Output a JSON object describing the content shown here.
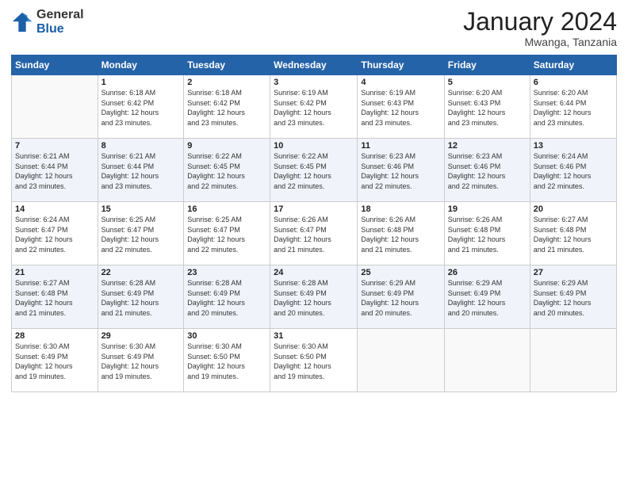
{
  "logo": {
    "general": "General",
    "blue": "Blue"
  },
  "title": "January 2024",
  "location": "Mwanga, Tanzania",
  "headers": [
    "Sunday",
    "Monday",
    "Tuesday",
    "Wednesday",
    "Thursday",
    "Friday",
    "Saturday"
  ],
  "weeks": [
    [
      {
        "day": "",
        "info": ""
      },
      {
        "day": "1",
        "info": "Sunrise: 6:18 AM\nSunset: 6:42 PM\nDaylight: 12 hours\nand 23 minutes."
      },
      {
        "day": "2",
        "info": "Sunrise: 6:18 AM\nSunset: 6:42 PM\nDaylight: 12 hours\nand 23 minutes."
      },
      {
        "day": "3",
        "info": "Sunrise: 6:19 AM\nSunset: 6:42 PM\nDaylight: 12 hours\nand 23 minutes."
      },
      {
        "day": "4",
        "info": "Sunrise: 6:19 AM\nSunset: 6:43 PM\nDaylight: 12 hours\nand 23 minutes."
      },
      {
        "day": "5",
        "info": "Sunrise: 6:20 AM\nSunset: 6:43 PM\nDaylight: 12 hours\nand 23 minutes."
      },
      {
        "day": "6",
        "info": "Sunrise: 6:20 AM\nSunset: 6:44 PM\nDaylight: 12 hours\nand 23 minutes."
      }
    ],
    [
      {
        "day": "7",
        "info": "Sunrise: 6:21 AM\nSunset: 6:44 PM\nDaylight: 12 hours\nand 23 minutes."
      },
      {
        "day": "8",
        "info": "Sunrise: 6:21 AM\nSunset: 6:44 PM\nDaylight: 12 hours\nand 23 minutes."
      },
      {
        "day": "9",
        "info": "Sunrise: 6:22 AM\nSunset: 6:45 PM\nDaylight: 12 hours\nand 22 minutes."
      },
      {
        "day": "10",
        "info": "Sunrise: 6:22 AM\nSunset: 6:45 PM\nDaylight: 12 hours\nand 22 minutes."
      },
      {
        "day": "11",
        "info": "Sunrise: 6:23 AM\nSunset: 6:46 PM\nDaylight: 12 hours\nand 22 minutes."
      },
      {
        "day": "12",
        "info": "Sunrise: 6:23 AM\nSunset: 6:46 PM\nDaylight: 12 hours\nand 22 minutes."
      },
      {
        "day": "13",
        "info": "Sunrise: 6:24 AM\nSunset: 6:46 PM\nDaylight: 12 hours\nand 22 minutes."
      }
    ],
    [
      {
        "day": "14",
        "info": "Sunrise: 6:24 AM\nSunset: 6:47 PM\nDaylight: 12 hours\nand 22 minutes."
      },
      {
        "day": "15",
        "info": "Sunrise: 6:25 AM\nSunset: 6:47 PM\nDaylight: 12 hours\nand 22 minutes."
      },
      {
        "day": "16",
        "info": "Sunrise: 6:25 AM\nSunset: 6:47 PM\nDaylight: 12 hours\nand 22 minutes."
      },
      {
        "day": "17",
        "info": "Sunrise: 6:26 AM\nSunset: 6:47 PM\nDaylight: 12 hours\nand 21 minutes."
      },
      {
        "day": "18",
        "info": "Sunrise: 6:26 AM\nSunset: 6:48 PM\nDaylight: 12 hours\nand 21 minutes."
      },
      {
        "day": "19",
        "info": "Sunrise: 6:26 AM\nSunset: 6:48 PM\nDaylight: 12 hours\nand 21 minutes."
      },
      {
        "day": "20",
        "info": "Sunrise: 6:27 AM\nSunset: 6:48 PM\nDaylight: 12 hours\nand 21 minutes."
      }
    ],
    [
      {
        "day": "21",
        "info": "Sunrise: 6:27 AM\nSunset: 6:48 PM\nDaylight: 12 hours\nand 21 minutes."
      },
      {
        "day": "22",
        "info": "Sunrise: 6:28 AM\nSunset: 6:49 PM\nDaylight: 12 hours\nand 21 minutes."
      },
      {
        "day": "23",
        "info": "Sunrise: 6:28 AM\nSunset: 6:49 PM\nDaylight: 12 hours\nand 20 minutes."
      },
      {
        "day": "24",
        "info": "Sunrise: 6:28 AM\nSunset: 6:49 PM\nDaylight: 12 hours\nand 20 minutes."
      },
      {
        "day": "25",
        "info": "Sunrise: 6:29 AM\nSunset: 6:49 PM\nDaylight: 12 hours\nand 20 minutes."
      },
      {
        "day": "26",
        "info": "Sunrise: 6:29 AM\nSunset: 6:49 PM\nDaylight: 12 hours\nand 20 minutes."
      },
      {
        "day": "27",
        "info": "Sunrise: 6:29 AM\nSunset: 6:49 PM\nDaylight: 12 hours\nand 20 minutes."
      }
    ],
    [
      {
        "day": "28",
        "info": "Sunrise: 6:30 AM\nSunset: 6:49 PM\nDaylight: 12 hours\nand 19 minutes."
      },
      {
        "day": "29",
        "info": "Sunrise: 6:30 AM\nSunset: 6:49 PM\nDaylight: 12 hours\nand 19 minutes."
      },
      {
        "day": "30",
        "info": "Sunrise: 6:30 AM\nSunset: 6:50 PM\nDaylight: 12 hours\nand 19 minutes."
      },
      {
        "day": "31",
        "info": "Sunrise: 6:30 AM\nSunset: 6:50 PM\nDaylight: 12 hours\nand 19 minutes."
      },
      {
        "day": "",
        "info": ""
      },
      {
        "day": "",
        "info": ""
      },
      {
        "day": "",
        "info": ""
      }
    ]
  ]
}
